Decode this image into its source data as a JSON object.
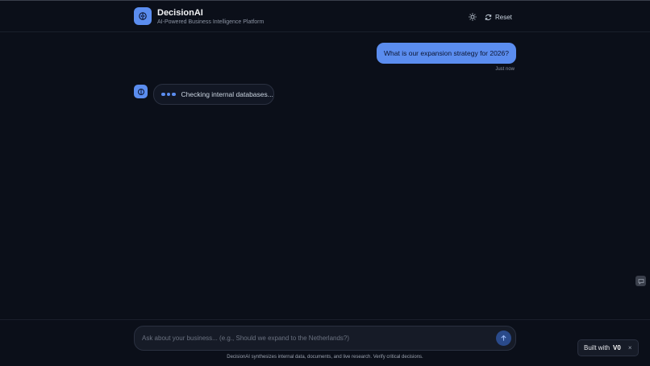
{
  "app": {
    "title": "DecisionAI",
    "subtitle": "AI-Powered Business Intelligence Platform"
  },
  "header": {
    "theme_icon": "sun-icon",
    "reset_label": "Reset",
    "reset_icon": "refresh-icon"
  },
  "chat": {
    "user_message": "What is our expansion strategy for 2026?",
    "user_time": "Just now",
    "status_text": "Checking internal databases..."
  },
  "composer": {
    "placeholder": "Ask about your business... (e.g., Should we expand to the Netherlands?)",
    "send_icon": "arrow-up-icon"
  },
  "footer": {
    "disclaimer": "DecisionAI synthesizes internal data, documents, and live research. Verify critical decisions."
  },
  "badge": {
    "label": "Built with",
    "logo": "V0",
    "close": "×"
  },
  "colors": {
    "background": "#0b0f19",
    "accent": "#5b8def"
  }
}
